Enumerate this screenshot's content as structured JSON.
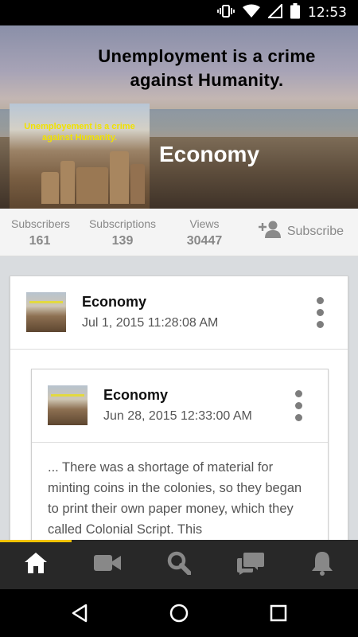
{
  "status_bar": {
    "time": "12:53"
  },
  "banner": {
    "headline_line1": "Unemployment is a crime",
    "headline_line2": "against Humanity.",
    "thumb_line1": "Unemployement is a crime",
    "thumb_line2": "against Humanity.",
    "title": "Economy"
  },
  "stats": {
    "subscribers": {
      "label": "Subscribers",
      "value": "161"
    },
    "subscriptions": {
      "label": "Subscriptions",
      "value": "139"
    },
    "views": {
      "label": "Views",
      "value": "30447"
    },
    "subscribe_label": "Subscribe"
  },
  "feed": {
    "outer_post": {
      "name": "Economy",
      "date": "Jul 1, 2015 11:28:08 AM"
    },
    "inner_post": {
      "name": "Economy",
      "date": "Jun 28, 2015 12:33:00 AM",
      "text": "... There was a shortage of material for minting coins in the colonies, so they began to print their own paper money, which they called Colonial Script. This"
    }
  },
  "tabs": [
    {
      "name": "home",
      "icon": "home-icon",
      "active": true
    },
    {
      "name": "videos",
      "icon": "video-camera-icon",
      "active": false
    },
    {
      "name": "search",
      "icon": "search-icon",
      "active": false
    },
    {
      "name": "messages",
      "icon": "chat-bubbles-icon",
      "active": false
    },
    {
      "name": "notifications",
      "icon": "bell-icon",
      "active": false
    }
  ],
  "colors": {
    "accent": "#f2c300",
    "tab_bar": "#282828",
    "banner_title": "#ffffff"
  }
}
